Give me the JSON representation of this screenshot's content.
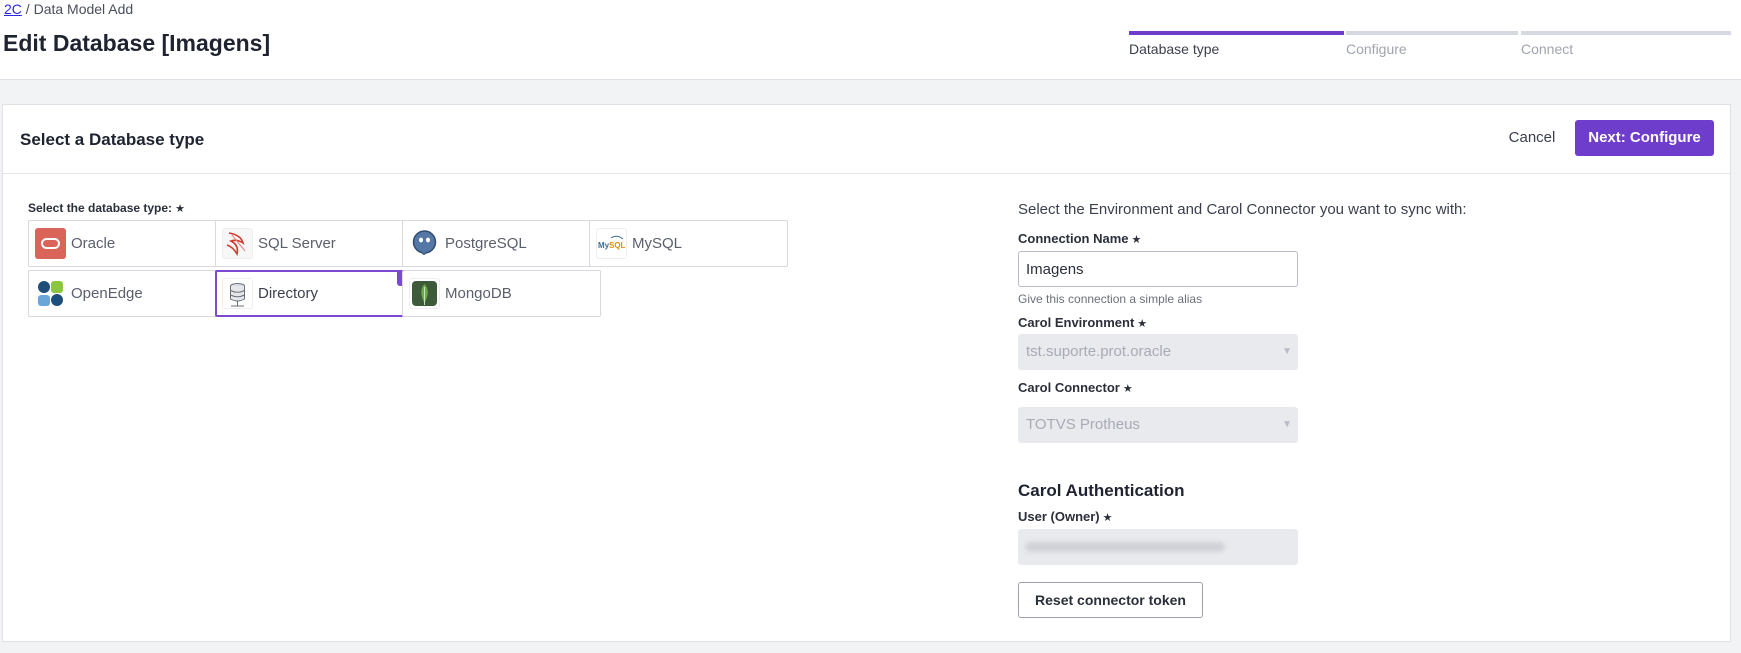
{
  "breadcrumb": {
    "link": "2C",
    "separator": " / ",
    "current": "Data Model Add"
  },
  "page_title": "Edit Database [Imagens]",
  "steps": [
    {
      "label": "Database type",
      "active": true
    },
    {
      "label": "Configure",
      "active": false
    },
    {
      "label": "Connect",
      "active": false
    }
  ],
  "card": {
    "title": "Select a Database type",
    "cancel_label": "Cancel",
    "next_label": "Next: Configure"
  },
  "db_select": {
    "label": "Select the database type:",
    "required_mark": "★",
    "options": [
      {
        "name": "Oracle",
        "icon": "oracle-icon",
        "selected": false
      },
      {
        "name": "SQL Server",
        "icon": "sql-server-icon",
        "selected": false
      },
      {
        "name": "PostgreSQL",
        "icon": "postgresql-icon",
        "selected": false
      },
      {
        "name": "MySQL",
        "icon": "mysql-icon",
        "selected": false
      },
      {
        "name": "OpenEdge",
        "icon": "openedge-icon",
        "selected": false
      },
      {
        "name": "Directory",
        "icon": "directory-icon",
        "selected": true
      },
      {
        "name": "MongoDB",
        "icon": "mongodb-icon",
        "selected": false
      }
    ]
  },
  "form": {
    "intro": "Select the Environment and Carol Connector you want to sync with:",
    "connection_name": {
      "label": "Connection Name",
      "value": "Imagens",
      "hint": "Give this connection a simple alias"
    },
    "carol_environment": {
      "label": "Carol Environment",
      "value": "tst.suporte.prot.oracle"
    },
    "carol_connector": {
      "label": "Carol Connector",
      "value": "TOTVS Protheus"
    },
    "auth_title": "Carol Authentication",
    "user_owner": {
      "label": "User (Owner)"
    },
    "reset_label": "Reset connector token"
  },
  "colors": {
    "accent": "#6f3dcc",
    "selected_border": "#7b4ad1"
  }
}
